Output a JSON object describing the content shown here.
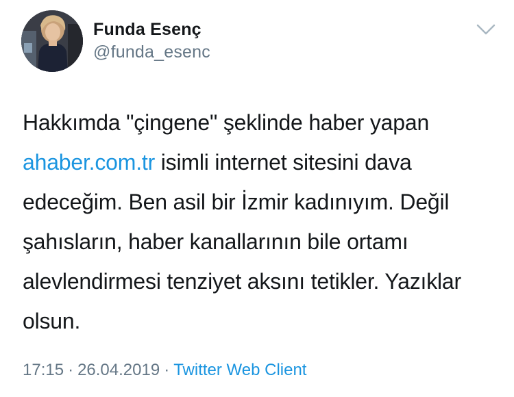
{
  "author": {
    "display_name": "Funda Esenç",
    "handle": "@funda_esenc"
  },
  "tweet": {
    "text_before_link": "Hakkımda \"çingene\" şeklinde haber yapan ",
    "link_text": "ahaber.com.tr",
    "text_after_link": " isimli internet sitesini dava edeceğim. Ben asil bir İzmir kadınıyım. Değil şahısların, haber kanallarının bile ortamı alevlendirmesi tenziyet aksını tetikler. Yazıklar olsun."
  },
  "meta": {
    "time": "17:15",
    "separator": "·",
    "date": "26.04.2019",
    "source": "Twitter Web Client"
  },
  "icons": {
    "menu": "chevron-down-icon"
  },
  "colors": {
    "text": "#14171a",
    "secondary": "#657786",
    "link": "#1b95e0"
  }
}
